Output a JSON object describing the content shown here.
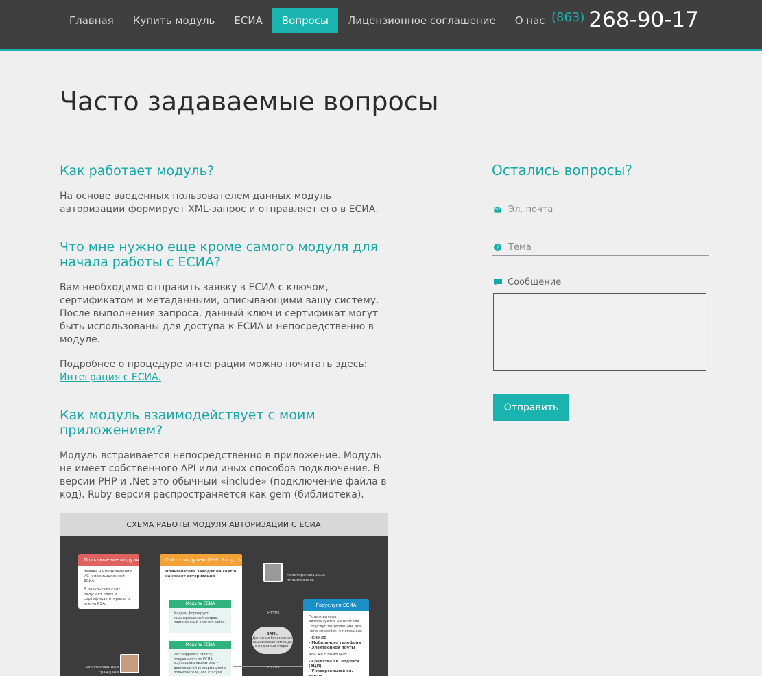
{
  "nav": {
    "items": [
      {
        "label": "Главная",
        "active": false
      },
      {
        "label": "Купить модуль",
        "active": false
      },
      {
        "label": "ЕСИА",
        "active": false
      },
      {
        "label": "Вопросы",
        "active": true
      },
      {
        "label": "Лицензионное соглашение",
        "active": false
      },
      {
        "label": "О нас",
        "active": false
      }
    ]
  },
  "phone": {
    "code": "(863)",
    "number": "268-90-17"
  },
  "page_title": "Часто задаваемые вопросы",
  "faq": [
    {
      "question": "Как работает модуль?",
      "answer": "На основе введенных пользователем данных модуль авторизации формирует XML-запрос и отправляет его в ЕСИА."
    },
    {
      "question": "Что мне нужно еще кроме самого модуля для начала работы с ЕСИА?",
      "answer": "Вам необходимо отправить заявку в ЕСИА с ключом, сертификатом и метаданными, описывающими вашу систему. После выполнения запроса, данный ключ и сертификат могут быть использованы для доступа к ЕСИА и непосредственно в модуле.",
      "extra": "Подробнее о процедуре интеграции можно почитать здесь:",
      "link": "Интеграция с ЕСИА."
    },
    {
      "question": "Как модуль взаимодействует с моим приложением?",
      "answer": "Модуль встраивается непосредственно в приложение. Модуль не имеет собственного API или иных способов подключения. В версии PHP и .Net это обычный «include» (подключение файла в код). Ruby версия распространяется как gem (библиотека)."
    }
  ],
  "scheme": {
    "title": "СХЕМА РАБОТЫ МОДУЛЯ АВТОРИЗАЦИИ С ЕСИА",
    "box_connect": {
      "title": "Подключение модуля",
      "text1": "Заявка на подключение ИС к промышленной ЕСИА.",
      "text2": "В результате сайт получает ключ и сертификат открытого ключа RSA."
    },
    "box_site": {
      "title": "Сайт с модулем",
      "title_extra": "(PHP, Ruby, .Net)",
      "text": "Пользователь заходит на сайт и начинает авторизацию"
    },
    "module1": {
      "title": "Модуль ЕСИА",
      "text": "Модуль формирует зашифрованный запрос, подписанный ключом сайта."
    },
    "module2": {
      "title": "Модуль ЕСИА",
      "text": "Расшифровка ответа, полученного от ЕСИА, выданным ключом RSA с достоверной информацией о пользователе, его статусе"
    },
    "unauth_user": "Неавторизованный пользователь",
    "auth_user": "Авторизованный граждани",
    "https1": "HTTPS",
    "https2": "HTTPS",
    "cloud": {
      "title": "SAML",
      "text": "Данные в безопасном зашифрованном виде с подписью сторон"
    },
    "box_gos": {
      "title": "Госуслуги ЕСИА",
      "text1": "Пользователь авторизуется на портале Госуслуг подходящим для него способом с помощью:",
      "text2": "- СНИЛС",
      "text3": "- Мобильного телефона",
      "text4": "- Электронной почты",
      "text5": "или же с помощью:",
      "text6": "- Средства эл. подписи (ЭЦП)",
      "text7": "- Универсальной эл. карты"
    }
  },
  "contact": {
    "title": "Остались вопросы?",
    "email_placeholder": "Эл. почта",
    "topic_placeholder": "Тема",
    "message_label": "Сообщение",
    "submit_label": "Отправить"
  }
}
